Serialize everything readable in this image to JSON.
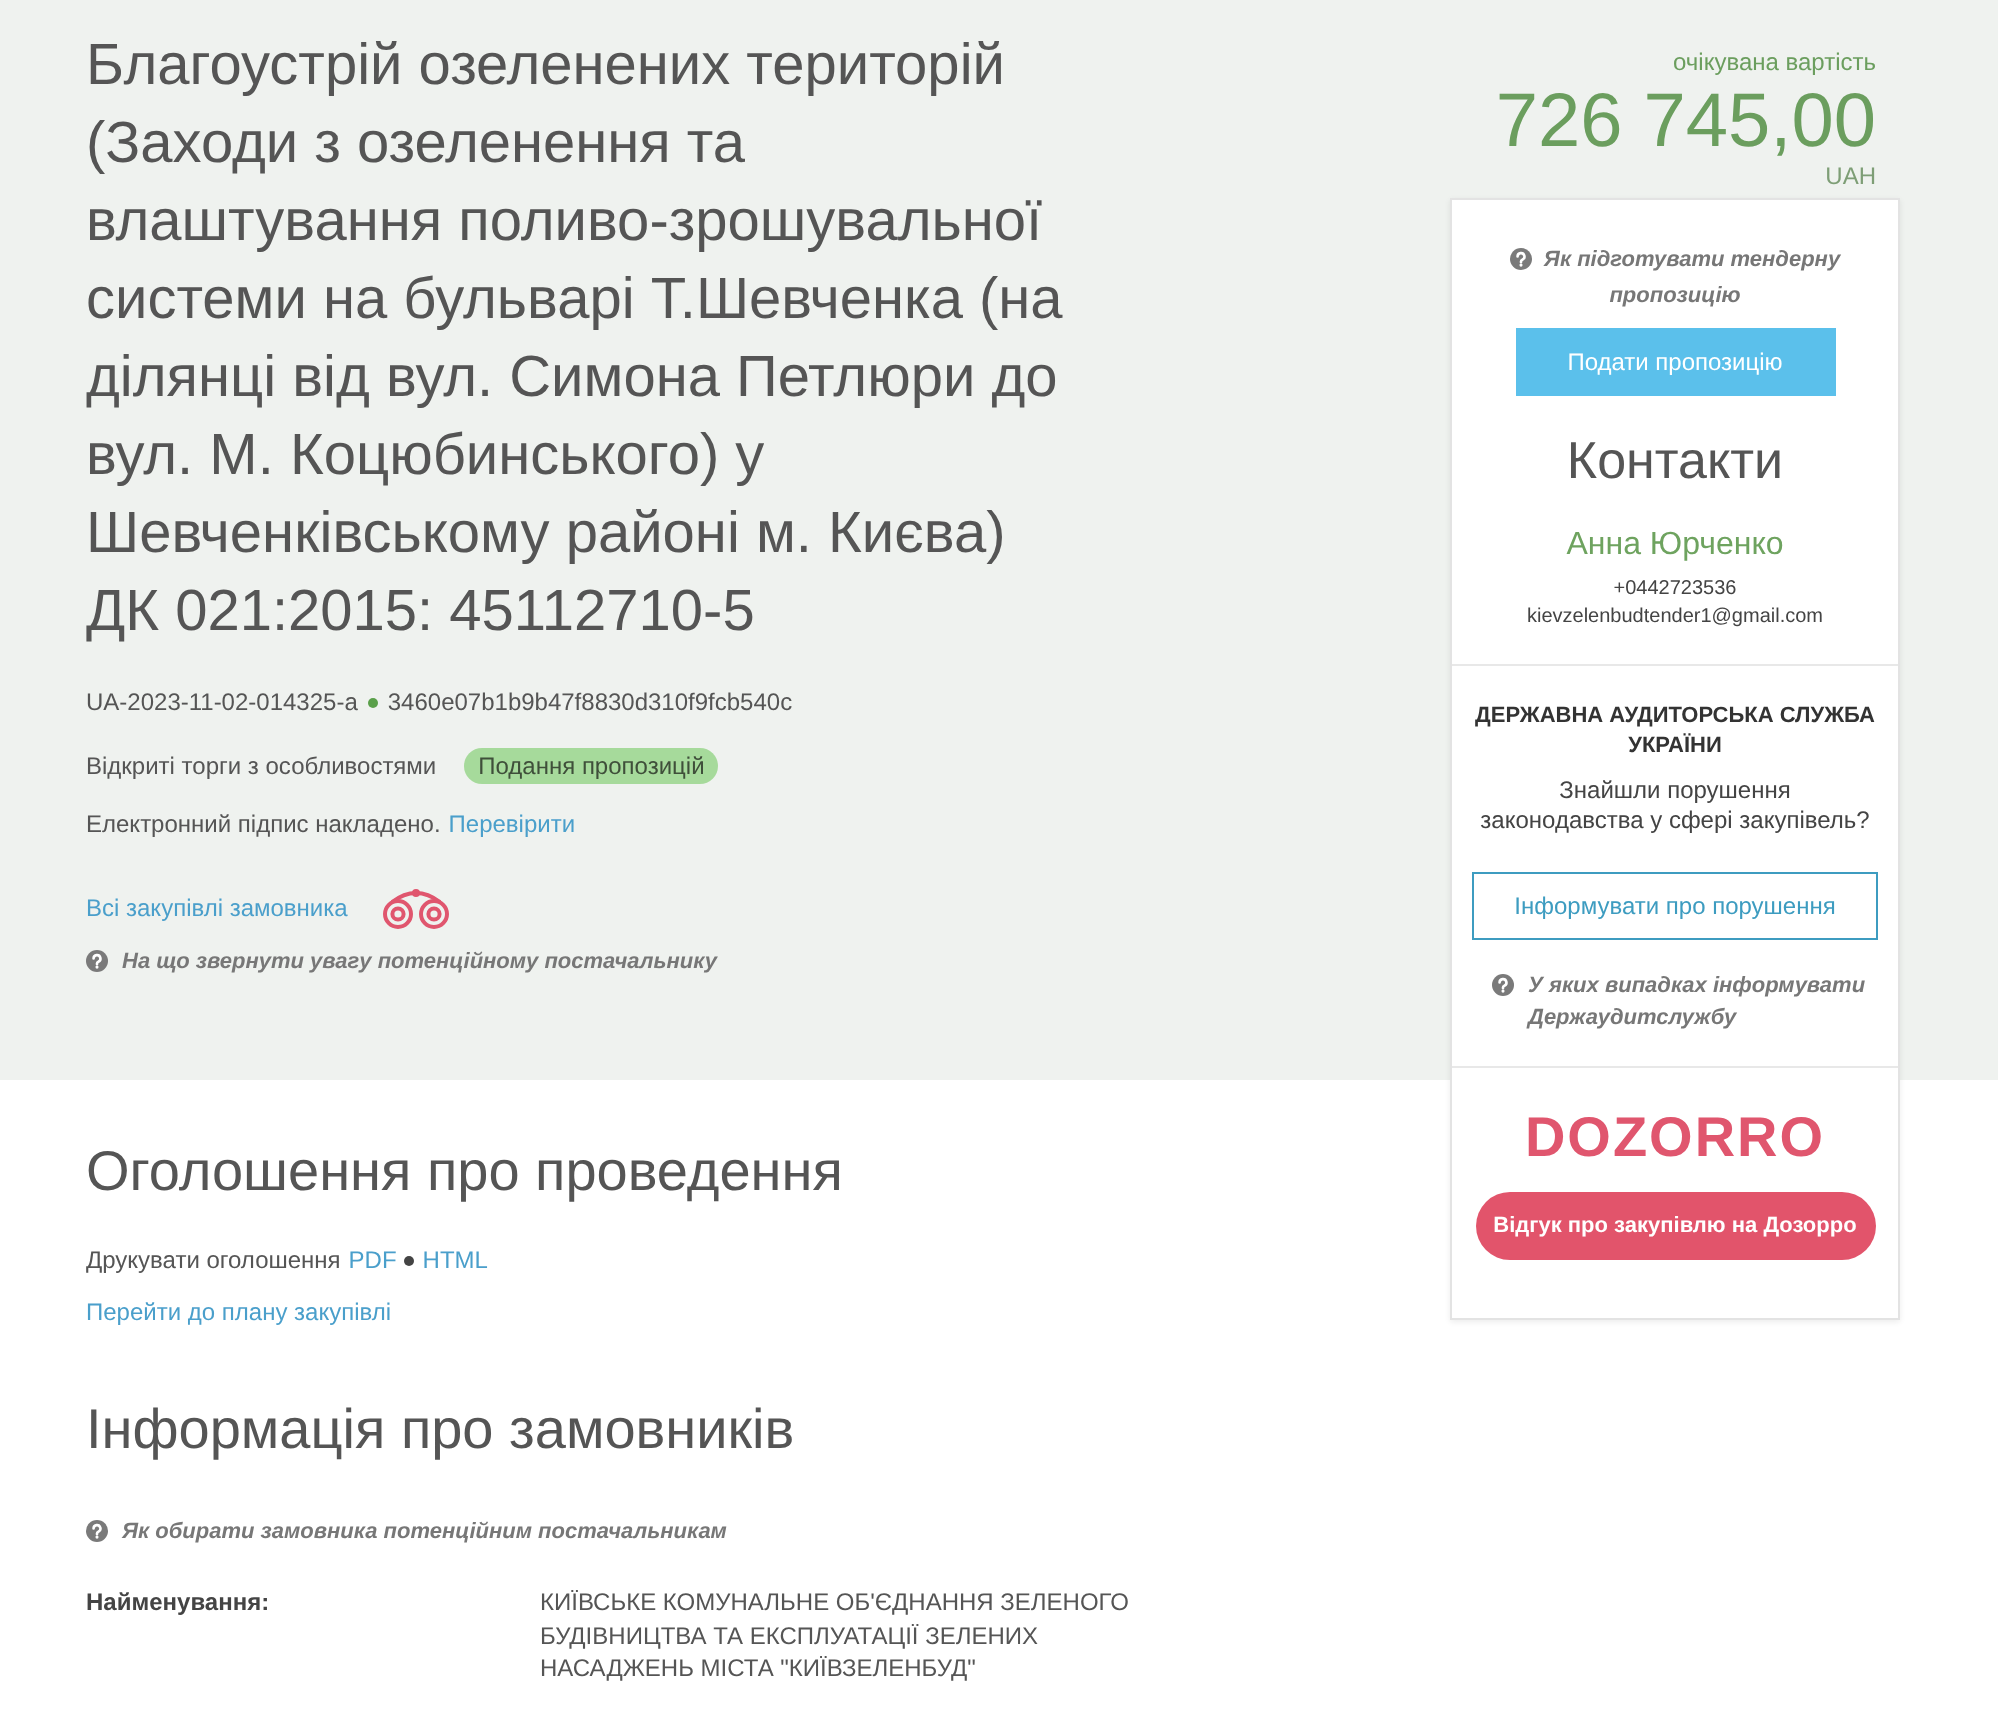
{
  "tender": {
    "title": "Благоустрій озеленених територій (Заходи з озеленення та влаштування поливо-зрошувальної системи на бульварі Т.Шевченка (на ділянці від вул. Симона Петлюри до вул. М. Коцюбинського) у Шевченківському районі м. Києва) ДК 021:2015: 45112710-5",
    "id": "UA-2023-11-02-014325-a",
    "hash": "3460e07b1b9b47f8830d310f9fcb540c",
    "procedure_type": "Відкриті торги з особливостями",
    "status_badge": "Подання пропозицій",
    "signature": {
      "text": "Електронний підпис накладено.",
      "link": "Перевірити"
    },
    "customer_link": "Всі закупівлі замовника",
    "help_link": "На що звернути увагу потенційному постачальнику"
  },
  "price": {
    "label": "очікувана вартість",
    "amount": "726 745,00",
    "currency": "UAH"
  },
  "sidebar": {
    "help_link": "Як підготувати тендерну пропозицію",
    "submit_button": "Подати пропозицію",
    "contacts": {
      "title": "Контакти",
      "name": "Анна Юрченко",
      "phone": "+0442723536",
      "email": "kievzelenbudtender1@gmail.com"
    },
    "audit": {
      "title": "ДЕРЖАВНА АУДИТОРСЬКА СЛУЖБА УКРАЇНИ",
      "text": "Знайшли порушення законодавства у сфері закупівель?",
      "button": "Інформувати про порушення",
      "help_link": "У яких випадках інформувати Держаудитслужбу"
    },
    "dozorro": {
      "logo": "DOZORRO",
      "button": "Відгук про закупівлю на Дозорро"
    }
  },
  "announcement": {
    "title": "Оголошення про проведення",
    "print_label": "Друкувати оголошення",
    "print_links": [
      "PDF",
      "HTML"
    ],
    "plan_link": "Перейти до плану закупівлі"
  },
  "customers": {
    "title": "Інформація про замовників",
    "help_link": "Як обирати замовника потенційним постачальникам",
    "fields": [
      {
        "label": "Найменування:",
        "value": "КИЇВСЬКЕ КОМУНАЛЬНЕ ОБ'ЄДНАННЯ ЗЕЛЕНОГО БУДІВНИЦТВА ТА ЕКСПЛУАТАЦІЇ ЗЕЛЕНИХ НАСАДЖЕНЬ МІСТА \"КИЇВЗЕЛЕНБУД\""
      }
    ]
  }
}
